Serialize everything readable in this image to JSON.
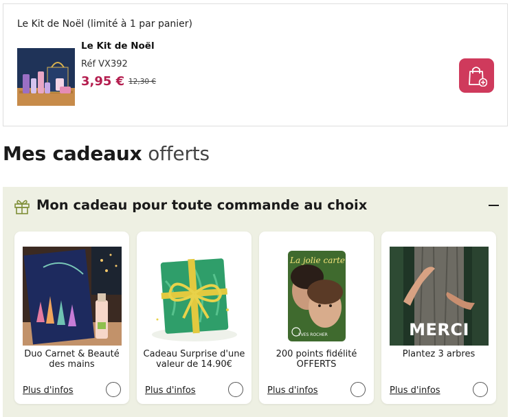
{
  "kit": {
    "heading": "Le Kit de Noël (limité à 1 par panier)",
    "name": "Le Kit de Noël",
    "ref": "Réf VX392",
    "price": "3,95 €",
    "old_price": "12,30 €",
    "image_icon": "gift-box-product-photo",
    "add_icon": "shopping-bag-plus-icon"
  },
  "section": {
    "title_bold": "Mes cadeaux",
    "title_light": "offerts"
  },
  "gift_panel": {
    "title": "Mon cadeau pour toute commande au choix",
    "icon": "gift-icon",
    "collapse_icon": "minus-icon",
    "items": [
      {
        "name": "Duo Carnet & Beauté des mains",
        "more_info": "Plus d'infos",
        "image": "notebook-and-hand-cream-photo"
      },
      {
        "name": "Cadeau Surprise d'une valeur de 14.90€",
        "more_info": "Plus d'infos",
        "image": "wrapped-gift-photo"
      },
      {
        "name": "200 points fidélité OFFERTS",
        "more_info": "Plus d'infos",
        "image": "loyalty-card-photo",
        "card_script": "La jolie carte",
        "card_brand": "YVES ROCHER"
      },
      {
        "name": "Plantez 3 arbres",
        "more_info": "Plus d'infos",
        "image": "tree-hug-photo",
        "image_text": "MERCI"
      }
    ]
  },
  "colors": {
    "accent": "#b41e4f",
    "bag_button": "#cf3a5c",
    "panel_bg": "#eef0e3"
  }
}
